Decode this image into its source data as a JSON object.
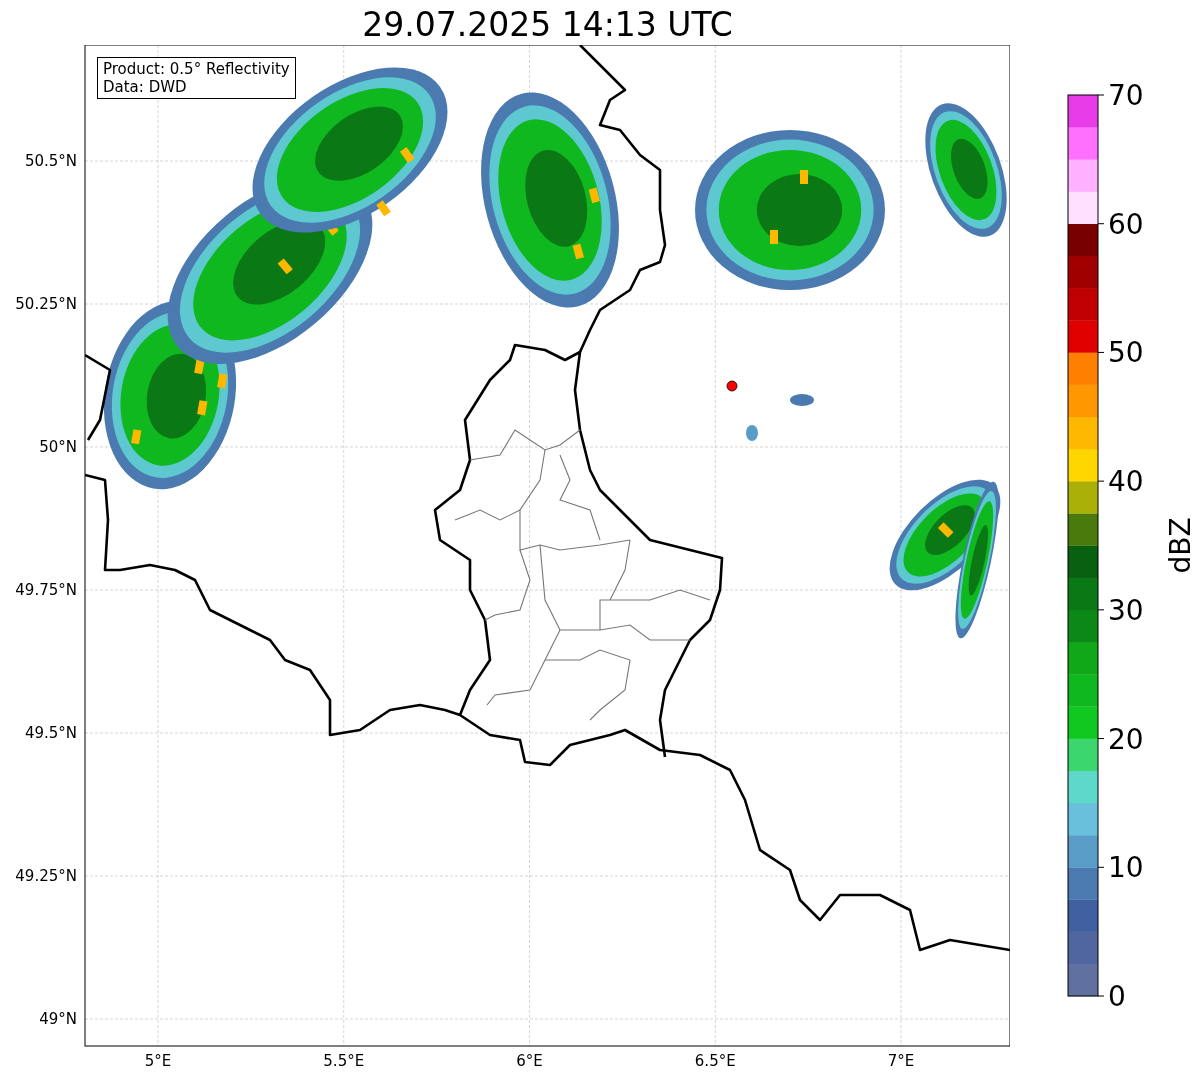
{
  "title": "29.07.2025 14:13 UTC",
  "legend": {
    "lines": [
      "Product: 0.5° Reflectivity",
      "Data: DWD"
    ]
  },
  "map": {
    "x_ticks": [
      "5°E",
      "5.5°E",
      "6°E",
      "6.5°E",
      "7°E"
    ],
    "y_ticks": [
      "50.5°N",
      "50.25°N",
      "50°N",
      "49.75°N",
      "49.5°N",
      "49.25°N",
      "49°N"
    ]
  },
  "colorbar": {
    "label": "dBZ",
    "ticks": [
      "70",
      "60",
      "50",
      "40",
      "30",
      "20",
      "10",
      "0"
    ],
    "segments": [
      {
        "color": "#6070a0"
      },
      {
        "color": "#5066a0"
      },
      {
        "color": "#4060a0"
      },
      {
        "color": "#4a7ab0"
      },
      {
        "color": "#5a9cc8"
      },
      {
        "color": "#68c0dc"
      },
      {
        "color": "#5ed8c8"
      },
      {
        "color": "#3cd66e"
      },
      {
        "color": "#10c820"
      },
      {
        "color": "#10b820"
      },
      {
        "color": "#10a818"
      },
      {
        "color": "#0c8818"
      },
      {
        "color": "#0a7814"
      },
      {
        "color": "#086010"
      },
      {
        "color": "#4a7a0c"
      },
      {
        "color": "#aab008"
      },
      {
        "color": "#ffd700"
      },
      {
        "color": "#ffb800"
      },
      {
        "color": "#ff9800"
      },
      {
        "color": "#ff8000"
      },
      {
        "color": "#e00000"
      },
      {
        "color": "#c00000"
      },
      {
        "color": "#a00000"
      },
      {
        "color": "#780000"
      },
      {
        "color": "#ffe0ff"
      },
      {
        "color": "#ffb0ff"
      },
      {
        "color": "#ff70ff"
      },
      {
        "color": "#e83ce8"
      }
    ]
  }
}
